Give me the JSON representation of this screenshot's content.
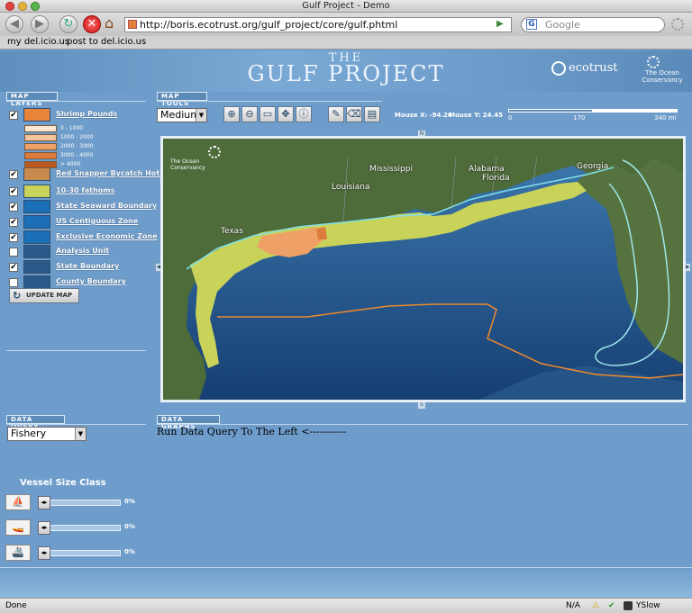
{
  "browser": {
    "window_title": "Gulf Project - Demo",
    "url": "http://boris.ecotrust.org/gulf_project/core/gulf.phtml",
    "search_placeholder": "Google",
    "bookmarks": [
      "my del.icio.us",
      "post to del.icio.us"
    ],
    "status_text": "Done",
    "status_na": "N/A",
    "yslow": "YSlow"
  },
  "header": {
    "title_top": "THE",
    "title_main": "GULF PROJECT",
    "logo_ecotrust": "ecotrust",
    "logo_conservancy_line1": "The Ocean",
    "logo_conservancy_line2": "Conservancy"
  },
  "map_layers": {
    "section_label": "MAP LAYERS",
    "items": [
      {
        "label": "Shrimp Pounds",
        "checked": true,
        "color": "#e8833a"
      },
      {
        "label": "Red Snapper Bycatch Hotspots",
        "checked": true,
        "color": "#c98a4e"
      },
      {
        "label": "10-30 fathoms",
        "checked": true,
        "color": "#c9d35a"
      },
      {
        "label": "State Seaward Boundary",
        "checked": true,
        "color": "#1b6fb6"
      },
      {
        "label": "US Contiguous Zone",
        "checked": true,
        "color": "#1b6fb6"
      },
      {
        "label": "Exclusive Economic Zone",
        "checked": true,
        "color": "#1b6fb6"
      },
      {
        "label": "Analysis Unit",
        "checked": false,
        "color": "#2a5a8a"
      },
      {
        "label": "State Boundary",
        "checked": true,
        "color": "#2a5a8a"
      },
      {
        "label": "County Boundary",
        "checked": false,
        "color": "#2a5a8a"
      }
    ],
    "shrimp_legend": [
      {
        "label": "0 - 1000",
        "color": "#fbe8d2"
      },
      {
        "label": "1000 - 2000",
        "color": "#f6c59a"
      },
      {
        "label": "2000 - 3000",
        "color": "#eea067"
      },
      {
        "label": "3000 - 4000",
        "color": "#dd7b3c"
      },
      {
        "label": "> 4000",
        "color": "#b95a22"
      }
    ],
    "update_button": "UPDATE MAP"
  },
  "map_tools": {
    "section_label": "MAP TOOLS",
    "size_select": "Medium",
    "mouse_x": "Mouse X: -94.26",
    "mouse_y": "Mouse Y: 24.45",
    "scale_ticks": [
      "0",
      "170",
      "340 mi"
    ]
  },
  "map": {
    "compass_n": "N",
    "compass_s": "S",
    "watermark_line1": "The Ocean",
    "watermark_line2": "Conservancy",
    "labels": [
      "Mississippi",
      "Alabama",
      "Georgia",
      "Louisiana",
      "Florida",
      "Texas"
    ]
  },
  "data_query": {
    "section_label": "DATA QUERY",
    "select_value": "Fishery",
    "vessel_title": "Vessel Size Class",
    "sliders": [
      {
        "value": "0%"
      },
      {
        "value": "0%"
      },
      {
        "value": "0%"
      }
    ]
  },
  "data_graphs": {
    "section_label": "DATA GRAPHS",
    "message": "Run Data Query To The Left <-----------"
  }
}
